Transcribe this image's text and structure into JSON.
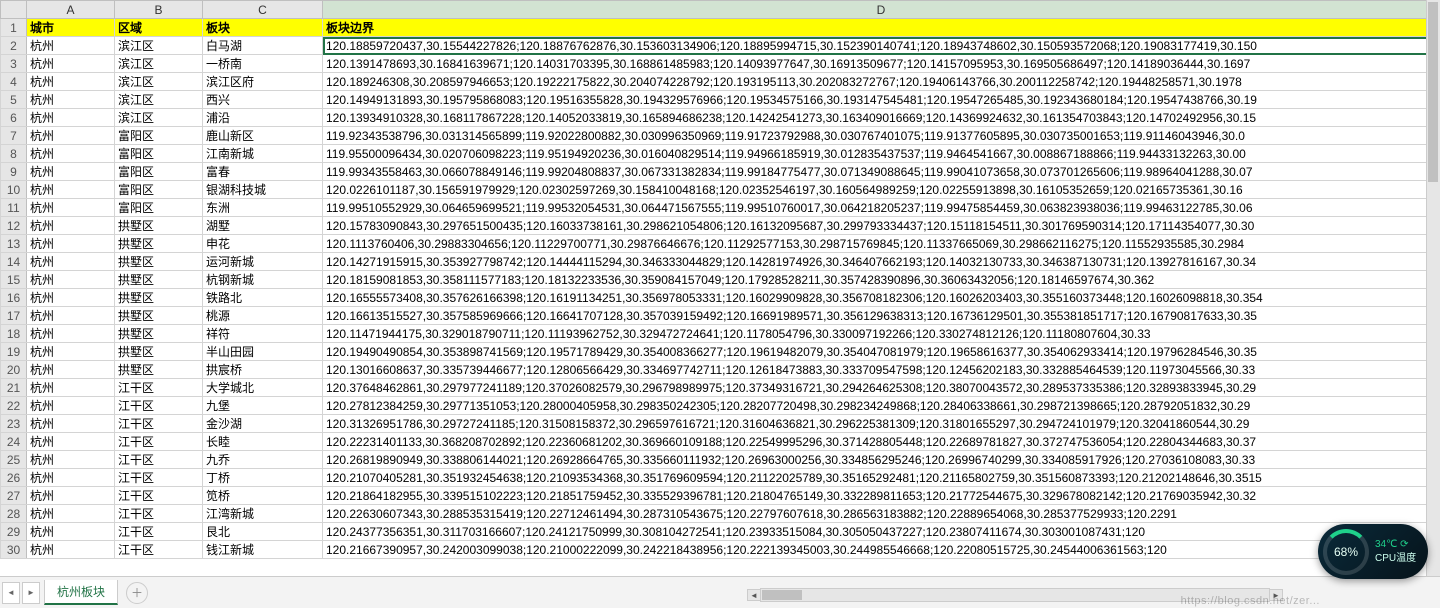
{
  "columns": [
    "A",
    "B",
    "C",
    "D"
  ],
  "header": {
    "city": "城市",
    "area": "区域",
    "block": "板块",
    "boundary": "板块边界"
  },
  "rows": [
    {
      "n": 2,
      "city": "杭州",
      "area": "滨江区",
      "block": "白马湖",
      "boundary": "120.18859720437,30.15544227826;120.18876762876,30.153603134906;120.18895994715,30.152390140741;120.18943748602,30.150593572068;120.19083177419,30.150"
    },
    {
      "n": 3,
      "city": "杭州",
      "area": "滨江区",
      "block": "一桥南",
      "boundary": "120.1391478693,30.16841639671;120.14031703395,30.168861485983;120.14093977647,30.16913509677;120.14157095953,30.169505686497;120.14189036444,30.1697"
    },
    {
      "n": 4,
      "city": "杭州",
      "area": "滨江区",
      "block": "滨江区府",
      "boundary": "120.189246308,30.208597946653;120.19222175822,30.204074228792;120.193195113,30.202083272767;120.19406143766,30.200112258742;120.19448258571,30.1978"
    },
    {
      "n": 5,
      "city": "杭州",
      "area": "滨江区",
      "block": "西兴",
      "boundary": "120.14949131893,30.195795868083;120.19516355828,30.194329576966;120.19534575166,30.193147545481;120.19547265485,30.192343680184;120.19547438766,30.19"
    },
    {
      "n": 6,
      "city": "杭州",
      "area": "滨江区",
      "block": "浦沿",
      "boundary": "120.13934910328,30.168117867228;120.14052033819,30.165894686238;120.14242541273,30.163409016669;120.14369924632,30.161354703843;120.14702492956,30.15"
    },
    {
      "n": 7,
      "city": "杭州",
      "area": "富阳区",
      "block": "鹿山新区",
      "boundary": "119.92343538796,30.031314565899;119.92022800882,30.030996350969;119.91723792988,30.030767401075;119.91377605895,30.030735001653;119.91146043946,30.0"
    },
    {
      "n": 8,
      "city": "杭州",
      "area": "富阳区",
      "block": "江南新城",
      "boundary": "119.95500096434,30.020706098223;119.95194920236,30.016040829514;119.94966185919,30.012835437537;119.9464541667,30.008867188866;119.94433132263,30.00"
    },
    {
      "n": 9,
      "city": "杭州",
      "area": "富阳区",
      "block": "富春",
      "boundary": "119.99343558463,30.066078849146;119.99204808837,30.067331382834;119.99184775477,30.071349088645;119.99041073658,30.073701265606;119.98964041288,30.07"
    },
    {
      "n": 10,
      "city": "杭州",
      "area": "富阳区",
      "block": "银湖科技城",
      "boundary": "120.0226101187,30.156591979929;120.02302597269,30.158410048168;120.02352546197,30.160564989259;120.02255913898,30.16105352659;120.02165735361,30.16"
    },
    {
      "n": 11,
      "city": "杭州",
      "area": "富阳区",
      "block": "东洲",
      "boundary": "119.99510552929,30.064659699521;119.99532054531,30.064471567555;119.99510760017,30.064218205237;119.99475854459,30.063823938036;119.99463122785,30.06"
    },
    {
      "n": 12,
      "city": "杭州",
      "area": "拱墅区",
      "block": "湖墅",
      "boundary": "120.15783090843,30.297651500435;120.16033738161,30.298621054806;120.16132095687,30.299793334437;120.15118154511,30.301769590314;120.17114354077,30.30"
    },
    {
      "n": 13,
      "city": "杭州",
      "area": "拱墅区",
      "block": "申花",
      "boundary": "120.1113760406,30.29883304656;120.11229700771,30.29876646676;120.11292577153,30.298715769845;120.11337665069,30.298662116275;120.11552935585,30.2984"
    },
    {
      "n": 14,
      "city": "杭州",
      "area": "拱墅区",
      "block": "运河新城",
      "boundary": "120.14271915915,30.353927798742;120.14444115294,30.346333044829;120.14281974926,30.346407662193;120.14032130733,30.346387130731;120.13927816167,30.34"
    },
    {
      "n": 15,
      "city": "杭州",
      "area": "拱墅区",
      "block": "杭钢新城",
      "boundary": "120.18159081853,30.358111577183;120.18132233536,30.359084157049;120.17928528211,30.357428390896,30.36063432056;120.18146597674,30.362"
    },
    {
      "n": 16,
      "city": "杭州",
      "area": "拱墅区",
      "block": "铁路北",
      "boundary": "120.16555573408,30.357626166398;120.16191134251,30.356978053331;120.16029909828,30.356708182306;120.16026203403,30.355160373448;120.16026098818,30.354"
    },
    {
      "n": 17,
      "city": "杭州",
      "area": "拱墅区",
      "block": "桃源",
      "boundary": "120.16613515527,30.357585969666;120.16641707128,30.357039159492;120.16691989571,30.356129638313;120.16736129501,30.355381851717;120.16790817633,30.35"
    },
    {
      "n": 18,
      "city": "杭州",
      "area": "拱墅区",
      "block": "祥符",
      "boundary": "120.11471944175,30.329018790711;120.11193962752,30.329472724641;120.1178054796,30.330097192266;120.330274812126;120.11180807604,30.33"
    },
    {
      "n": 19,
      "city": "杭州",
      "area": "拱墅区",
      "block": "半山田园",
      "boundary": "120.19490490854,30.353898741569;120.19571789429,30.354008366277;120.19619482079,30.354047081979;120.19658616377,30.354062933414;120.19796284546,30.35"
    },
    {
      "n": 20,
      "city": "杭州",
      "area": "拱墅区",
      "block": "拱宸桥",
      "boundary": "120.13016608637,30.335739446677;120.12806566429,30.334697742711;120.12618473883,30.333709547598;120.12456202183,30.332885464539;120.11973045566,30.33"
    },
    {
      "n": 21,
      "city": "杭州",
      "area": "江干区",
      "block": "大学城北",
      "boundary": "120.37648462861,30.297977241189;120.37026082579,30.296798989975;120.37349316721,30.294264625308;120.38070043572,30.289537335386;120.32893833945,30.29"
    },
    {
      "n": 22,
      "city": "杭州",
      "area": "江干区",
      "block": "九堡",
      "boundary": "120.27812384259,30.29771351053;120.28000405958,30.298350242305;120.28207720498,30.298234249868;120.28406338661,30.298721398665;120.28792051832,30.29"
    },
    {
      "n": 23,
      "city": "杭州",
      "area": "江干区",
      "block": "金沙湖",
      "boundary": "120.31326951786,30.29727241185;120.31508158372,30.296597616721;120.31604636821,30.296225381309;120.31801655297,30.294724101979;120.32041860544,30.29"
    },
    {
      "n": 24,
      "city": "杭州",
      "area": "江干区",
      "block": "长睦",
      "boundary": "120.22231401133,30.368208702892;120.22360681202,30.369660109188;120.22549995296,30.371428805448;120.22689781827,30.372747536054;120.22804344683,30.37"
    },
    {
      "n": 25,
      "city": "杭州",
      "area": "江干区",
      "block": "九乔",
      "boundary": "120.26819890949,30.338806144021;120.26928664765,30.335660111932;120.26963000256,30.334856295246;120.26996740299,30.334085917926;120.27036108083,30.33"
    },
    {
      "n": 26,
      "city": "杭州",
      "area": "江干区",
      "block": "丁桥",
      "boundary": "120.21070405281,30.351932454638;120.21093534368,30.351769609594;120.21122025789,30.35165292481;120.21165802759,30.351560873393;120.21202148646,30.3515"
    },
    {
      "n": 27,
      "city": "杭州",
      "area": "江干区",
      "block": "笕桥",
      "boundary": "120.21864182955,30.339515102223;120.21851759452,30.335529396781;120.21804765149,30.332289811653;120.21772544675,30.329678082142;120.21769035942,30.32"
    },
    {
      "n": 28,
      "city": "杭州",
      "area": "江干区",
      "block": "江湾新城",
      "boundary": "120.22630607343,30.288535315419;120.22712461494,30.287310543675;120.22797607618,30.286563183882;120.22889654068,30.285377529933;120.2291"
    },
    {
      "n": 29,
      "city": "杭州",
      "area": "江干区",
      "block": "艮北",
      "boundary": "120.24377356351,30.311703166607;120.24121750999,30.308104272541;120.23933515084,30.305050437227;120.23807411674,30.303001087431;120"
    },
    {
      "n": 30,
      "city": "杭州",
      "area": "江干区",
      "block": "钱江新城",
      "boundary": "120.21667390957,30.242003099038;120.21000222099,30.242218438956;120.222139345003,30.244985546668;120.22080515725,30.24544006361563;120"
    }
  ],
  "tab": {
    "active": "杭州板块"
  },
  "widget": {
    "percent": "68%",
    "temp": "34℃",
    "label": "CPU温度"
  },
  "watermark": "https://blog.csdn.net/zer..."
}
